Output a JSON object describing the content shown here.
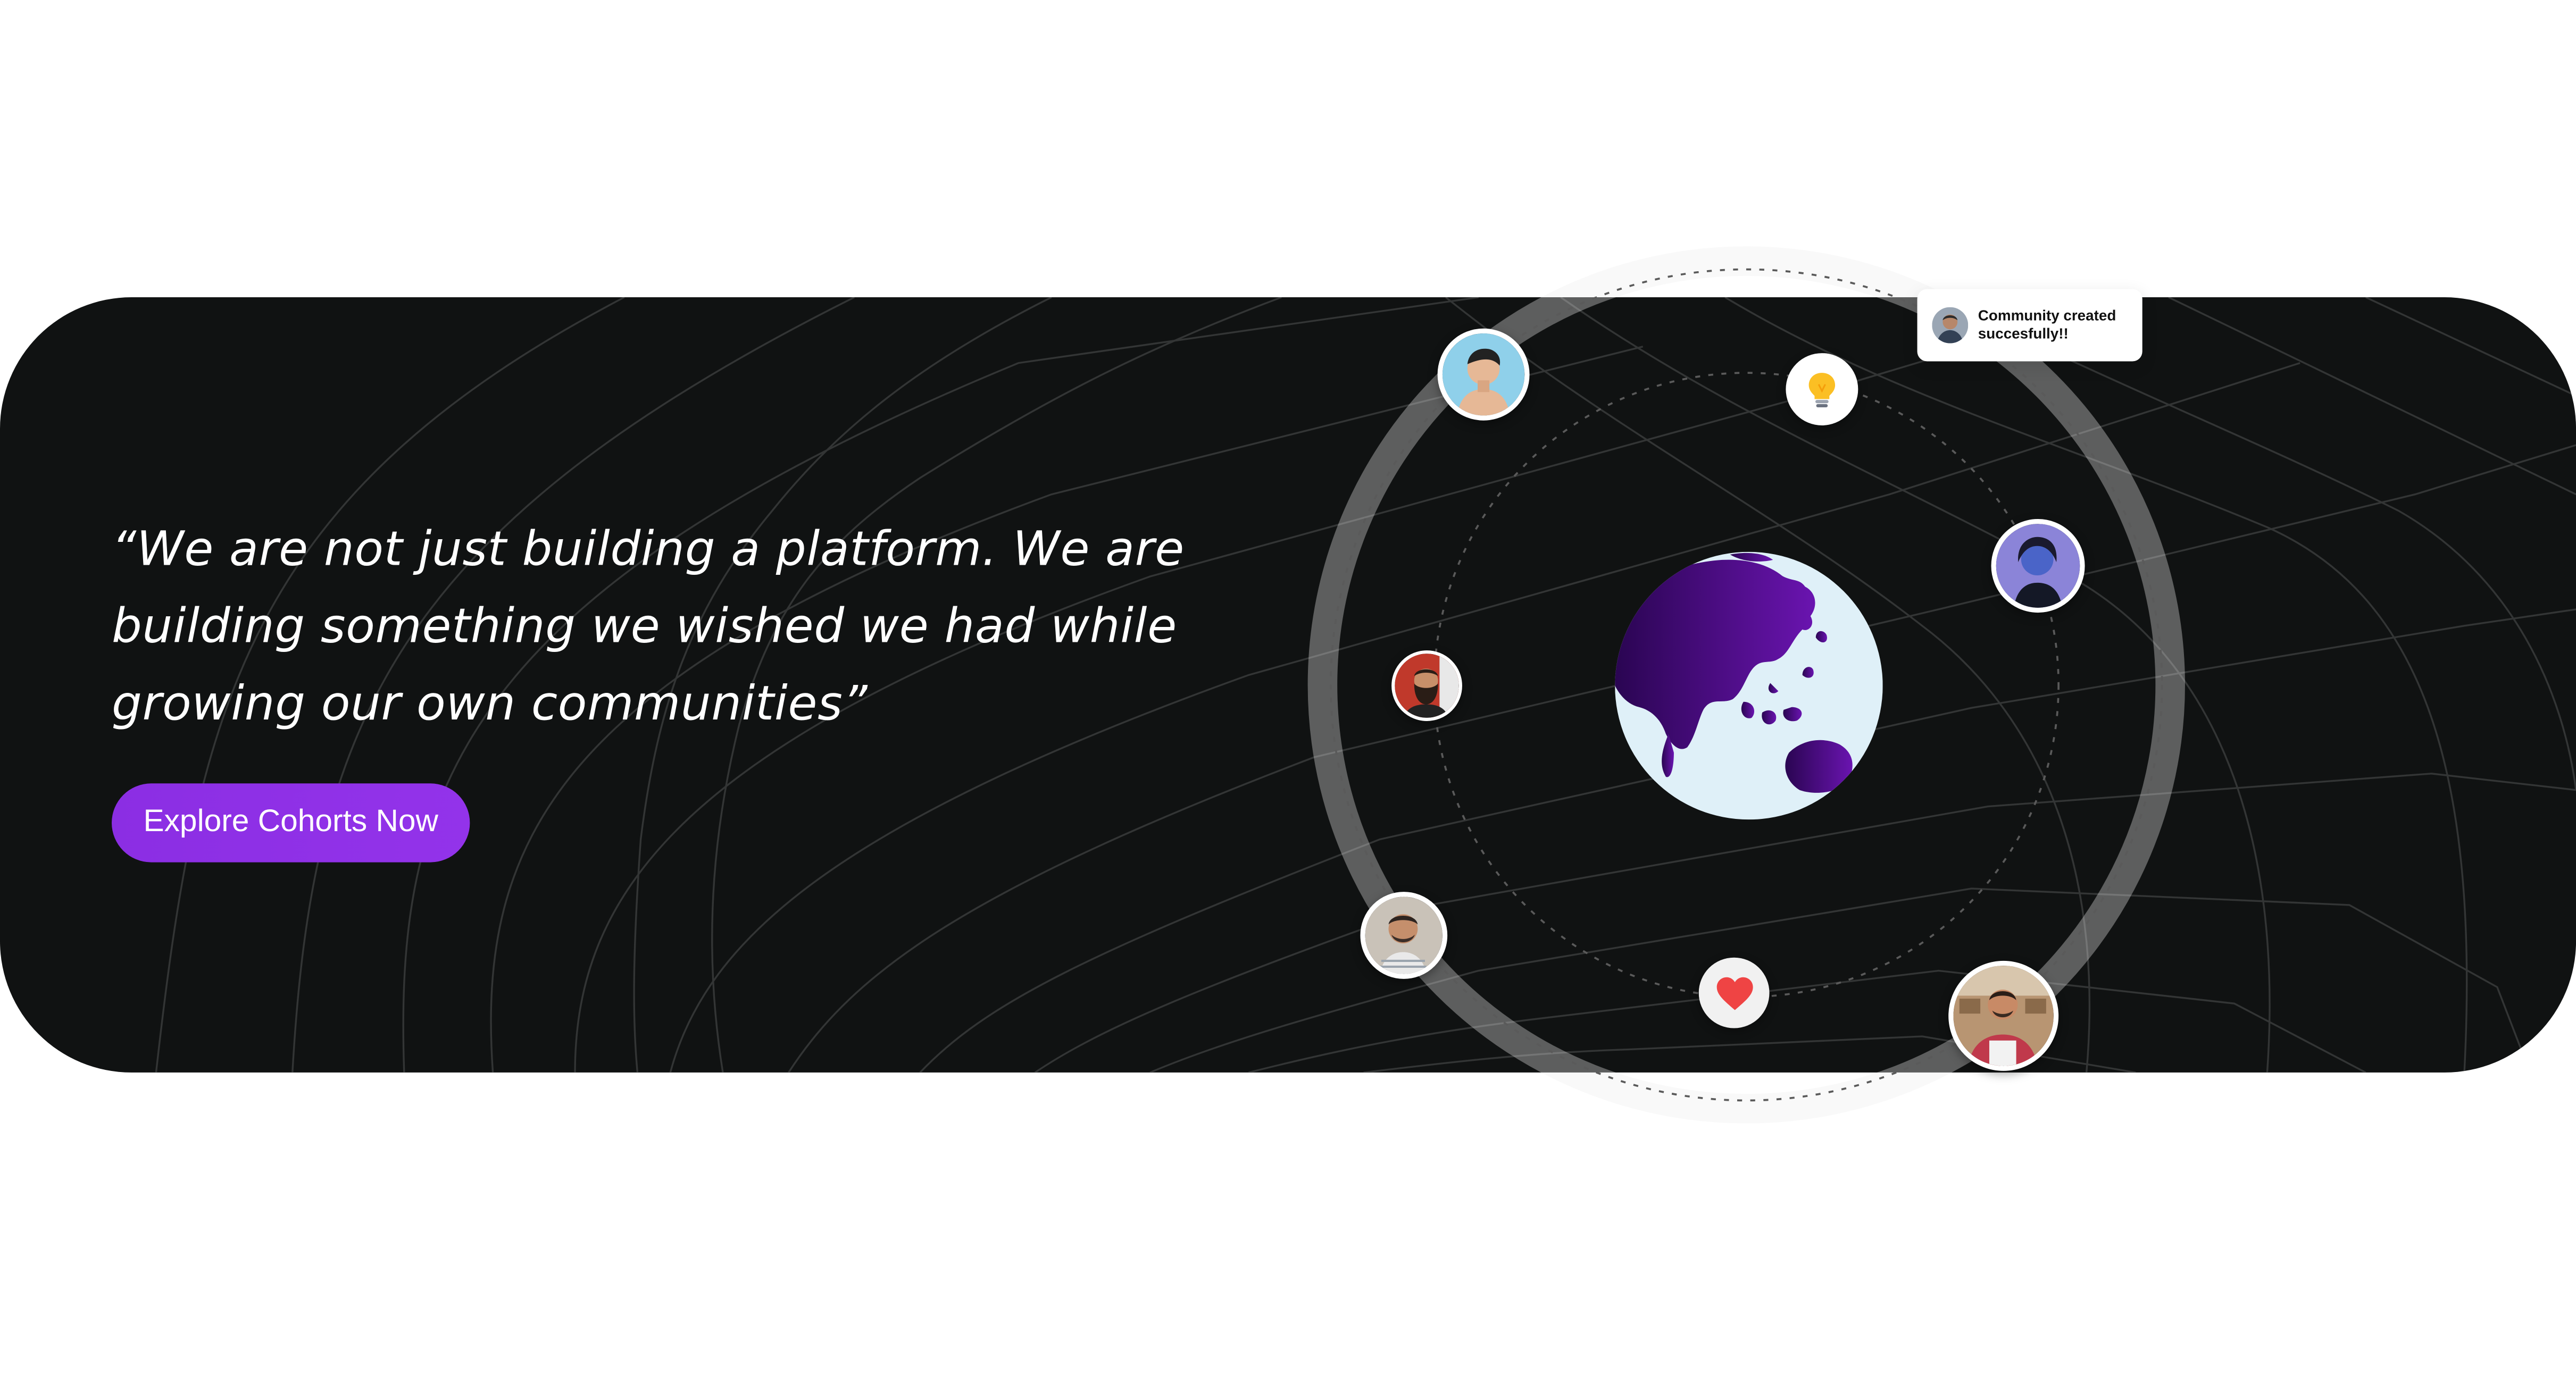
{
  "hero": {
    "quote": "“We are not just building a platform. We are building something we wished we had while growing our own communities”",
    "cta_label": "Explore Cohorts Now"
  },
  "toast": {
    "message": "Community created succesfully!!"
  },
  "icons": {
    "lightbulb": "lightbulb-icon",
    "heart": "heart-icon",
    "globe": "globe-icon"
  },
  "colors": {
    "card_background": "#101212",
    "accent": "#9333ea",
    "globe_ocean": "#dff0f8",
    "globe_land": "#4b0a80",
    "heart": "#ef4444"
  }
}
